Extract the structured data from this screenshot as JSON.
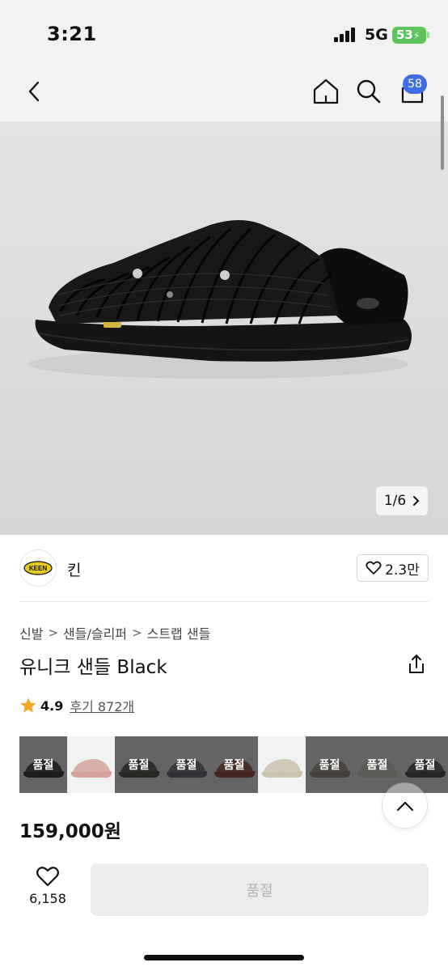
{
  "status": {
    "time": "3:21",
    "network": "5G",
    "battery": "53"
  },
  "nav": {
    "cart_count": "58",
    "icons": [
      "back-icon",
      "home-icon",
      "search-icon",
      "cart-icon"
    ]
  },
  "gallery": {
    "indicator": "1/6"
  },
  "brand": {
    "name": "킨",
    "logo_text": "KEEN",
    "likes": "2.3만"
  },
  "breadcrumb": [
    "신발",
    "샌들/슬리퍼",
    "스트랩 샌들"
  ],
  "product": {
    "title": "유니크 샌들 Black",
    "rating": "4.9",
    "reviews": "후기 872개",
    "price": "159,000원"
  },
  "swatches": [
    {
      "label": "품절",
      "color": "#2a2a2a",
      "bg": "#9a9a9a"
    },
    {
      "label": "",
      "color": "#d6a39a",
      "bg": "#f2f2f2"
    },
    {
      "label": "품절",
      "color": "#3b3b36",
      "bg": "#9a9a9a"
    },
    {
      "label": "품절",
      "color": "#4a4e52",
      "bg": "#9a9a9a"
    },
    {
      "label": "품절",
      "color": "#6b3b2e",
      "bg": "#9a9a9a"
    },
    {
      "label": "",
      "color": "#c9c3ad",
      "bg": "#f2f2f2"
    },
    {
      "label": "품절",
      "color": "#6b645a",
      "bg": "#9a9a9a"
    },
    {
      "label": "품절",
      "color": "#8a8a84",
      "bg": "#9a9a9a"
    },
    {
      "label": "품절",
      "color": "#3a3a3a",
      "bg": "#9a9a9a"
    }
  ],
  "wishlist": {
    "count": "6,158"
  },
  "buy": {
    "label": "품절"
  },
  "colors": {
    "accent": "#3d6de6",
    "star": "#f5a623",
    "battery": "#5ec35b"
  }
}
